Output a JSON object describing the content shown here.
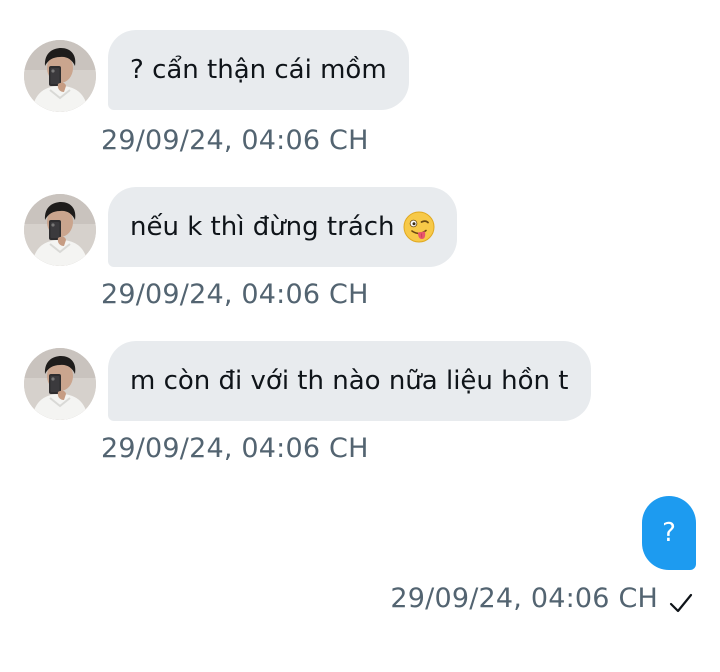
{
  "conversation": {
    "messages": [
      {
        "direction": "incoming",
        "text": "? cẩn thận cái mồm",
        "timestamp": "29/09/24, 04:06 CH",
        "avatar": "contact-avatar"
      },
      {
        "direction": "incoming",
        "text": "nếu k thì đừng trách",
        "emoji": "winking-face-with-tongue",
        "timestamp": "29/09/24, 04:06 CH",
        "avatar": "contact-avatar"
      },
      {
        "direction": "incoming",
        "text": "m còn đi với th nào nữa liệu hồn t",
        "timestamp": "29/09/24, 04:06 CH",
        "avatar": "contact-avatar"
      },
      {
        "direction": "outgoing",
        "text": "?",
        "timestamp": "29/09/24, 04:06 CH",
        "status_icon": "checkmark-icon"
      }
    ]
  },
  "colors": {
    "incoming_bubble": "#e8ebee",
    "outgoing_bubble": "#1d9bf0",
    "timestamp_text": "#536471",
    "message_text": "#0f1419"
  }
}
